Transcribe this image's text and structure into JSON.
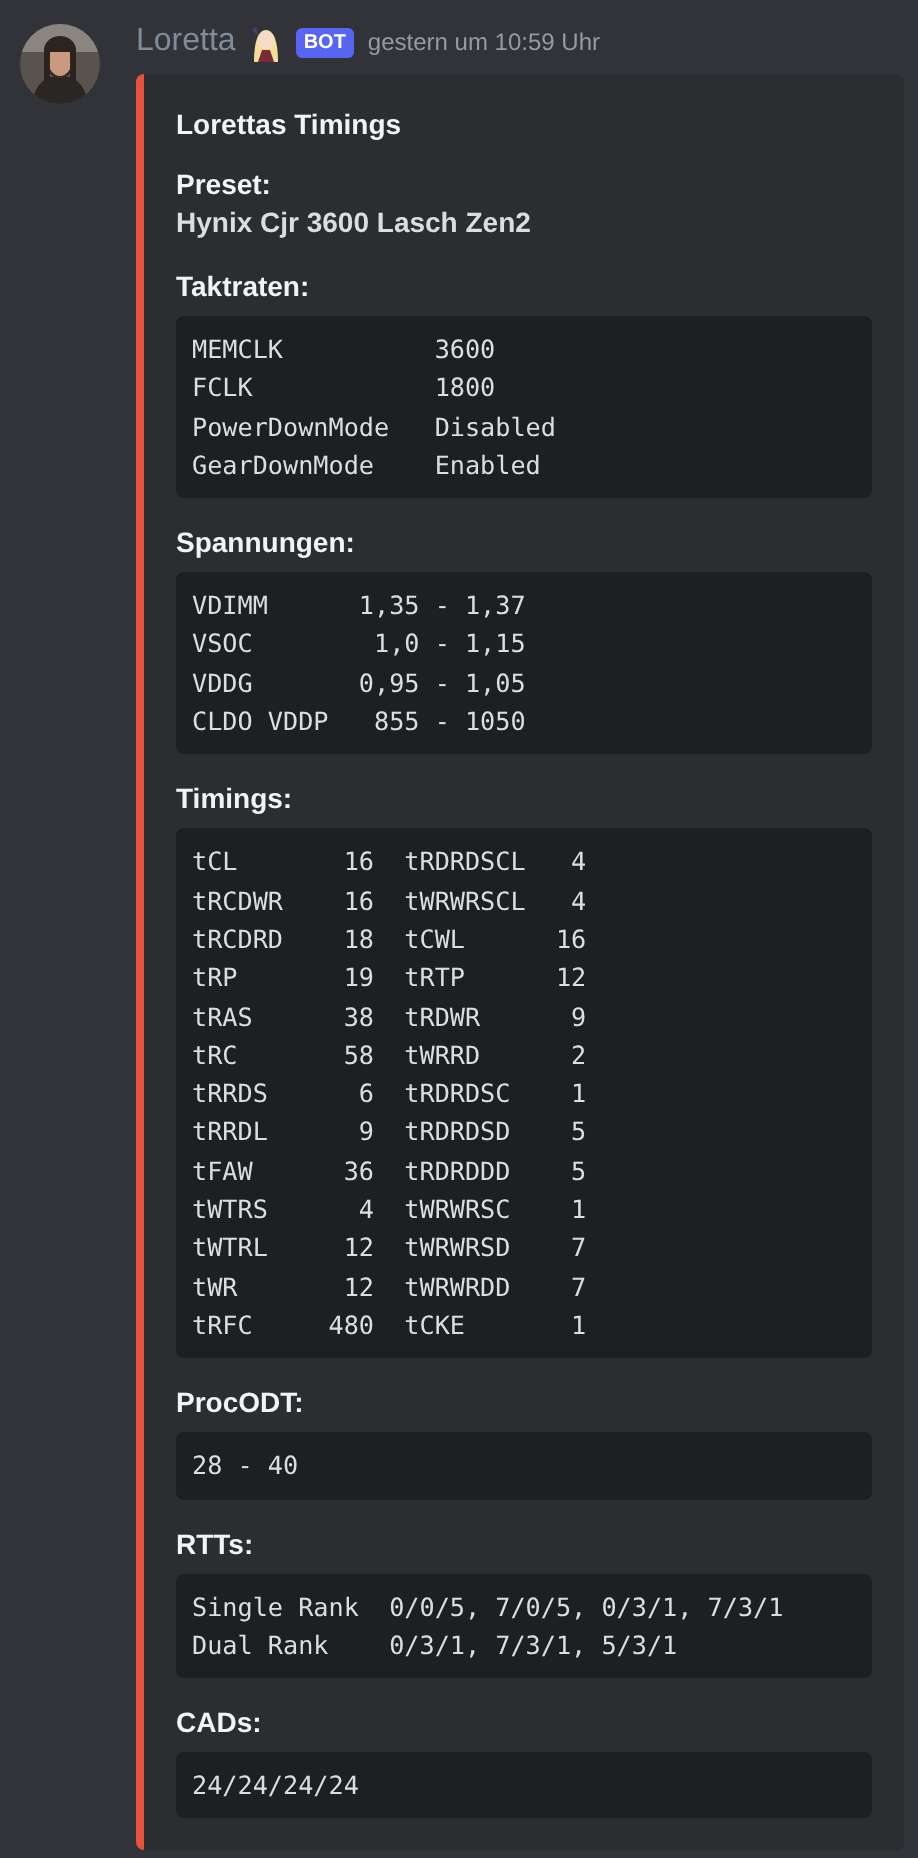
{
  "message": {
    "author": "Loretta",
    "badge": "BOT",
    "timestamp": "gestern um 10:59 Uhr"
  },
  "embed": {
    "title": "Lorettas Timings",
    "fields": [
      {
        "name": "Preset:",
        "kind": "text",
        "value": "Hynix Cjr 3600 Lasch Zen2"
      },
      {
        "name": "Taktraten:",
        "kind": "code",
        "lines": [
          "MEMCLK          3600",
          "FCLK            1800",
          "PowerDownMode   Disabled",
          "GearDownMode    Enabled"
        ]
      },
      {
        "name": "Spannungen:",
        "kind": "code",
        "lines": [
          "VDIMM      1,35 - 1,37",
          "VSOC        1,0 - 1,15",
          "VDDG       0,95 - 1,05",
          "CLDO VDDP   855 - 1050"
        ]
      },
      {
        "name": "Timings:",
        "kind": "code",
        "lines": [
          "tCL       16  tRDRDSCL   4",
          "tRCDWR    16  tWRWRSCL   4",
          "tRCDRD    18  tCWL      16",
          "tRP       19  tRTP      12",
          "tRAS      38  tRDWR      9",
          "tRC       58  tWRRD      2",
          "tRRDS      6  tRDRDSC    1",
          "tRRDL      9  tRDRDSD    5",
          "tFAW      36  tRDRDDD    5",
          "tWTRS      4  tWRWRSC    1",
          "tWTRL     12  tWRWRSD    7",
          "tWR       12  tWRWRDD    7",
          "tRFC     480  tCKE       1"
        ]
      },
      {
        "name": "ProcODT:",
        "kind": "code",
        "lines": [
          "28 - 40"
        ]
      },
      {
        "name": "RTTs:",
        "kind": "code",
        "lines": [
          "Single Rank  0/0/5, 7/0/5, 0/3/1, 7/3/1",
          "Dual Rank    0/3/1, 7/3/1, 5/3/1"
        ]
      },
      {
        "name": "CADs:",
        "kind": "code",
        "lines": [
          "24/24/24/24"
        ]
      }
    ]
  }
}
